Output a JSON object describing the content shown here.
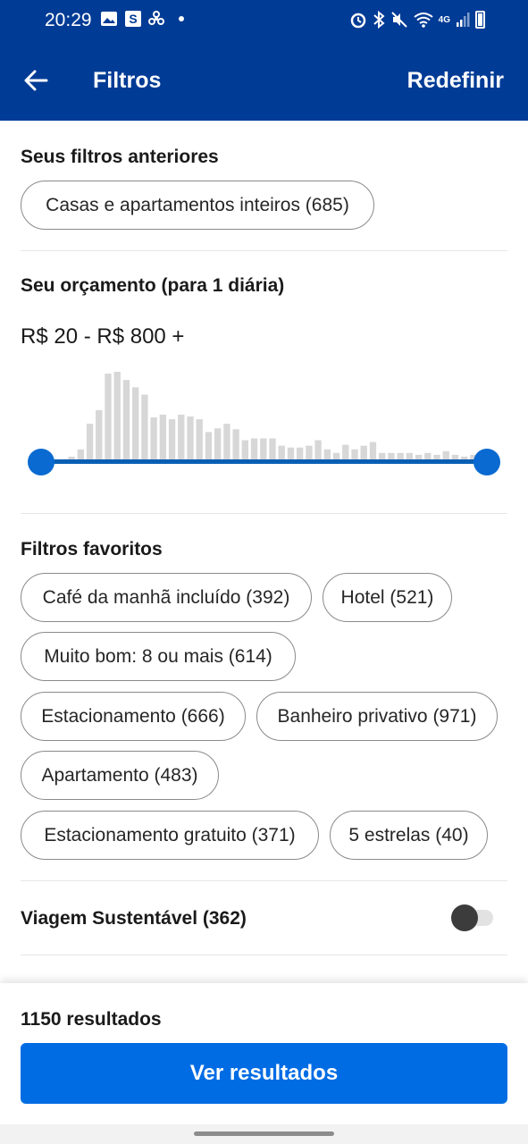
{
  "status_bar": {
    "time": "20:29",
    "left_icons": [
      "image-icon",
      "s-app-icon",
      "fan-icon",
      "dot-icon"
    ],
    "right_icons": [
      "alarm-icon",
      "bluetooth-icon",
      "mute-icon",
      "wifi-icon",
      "4g-icon",
      "signal-icon",
      "battery-icon"
    ],
    "network_label": "4G"
  },
  "appbar": {
    "title": "Filtros",
    "reset_label": "Redefinir",
    "color": "#003b95"
  },
  "previous_filters": {
    "title": "Seus filtros anteriores",
    "chips": [
      "Casas e apartamentos inteiros (685)"
    ]
  },
  "budget": {
    "title": "Seu orçamento (para 1 diária)",
    "range_label": "R$ 20 - R$ 800 +",
    "min_selected_fraction": 0,
    "max_selected_fraction": 1
  },
  "chart_data": {
    "type": "bar",
    "values": [
      4,
      12,
      40,
      55,
      95,
      97,
      88,
      80,
      72,
      47,
      50,
      45,
      50,
      48,
      45,
      31,
      35,
      40,
      34,
      22,
      24,
      24,
      24,
      16,
      14,
      14,
      16,
      22,
      12,
      8,
      17,
      12,
      16,
      20,
      8,
      8,
      8,
      8,
      6,
      8,
      6,
      10,
      6,
      4,
      6
    ],
    "color": "#d7d7d7",
    "xlabel": "",
    "ylabel": ""
  },
  "favorites": {
    "title": "Filtros favoritos",
    "chips": [
      "Café da manhã incluído (392)",
      "Hotel (521)",
      "Muito bom: 8 ou mais (614)",
      "Estacionamento (666)",
      "Banheiro privativo (971)",
      "Apartamento (483)",
      "Estacionamento gratuito (371)",
      "5 estrelas (40)"
    ]
  },
  "sustainable": {
    "label": "Viagem Sustentável (362)",
    "enabled": false
  },
  "footer": {
    "results_label": "1150 resultados",
    "cta_label": "Ver resultados",
    "cta_color": "#006ce4"
  }
}
